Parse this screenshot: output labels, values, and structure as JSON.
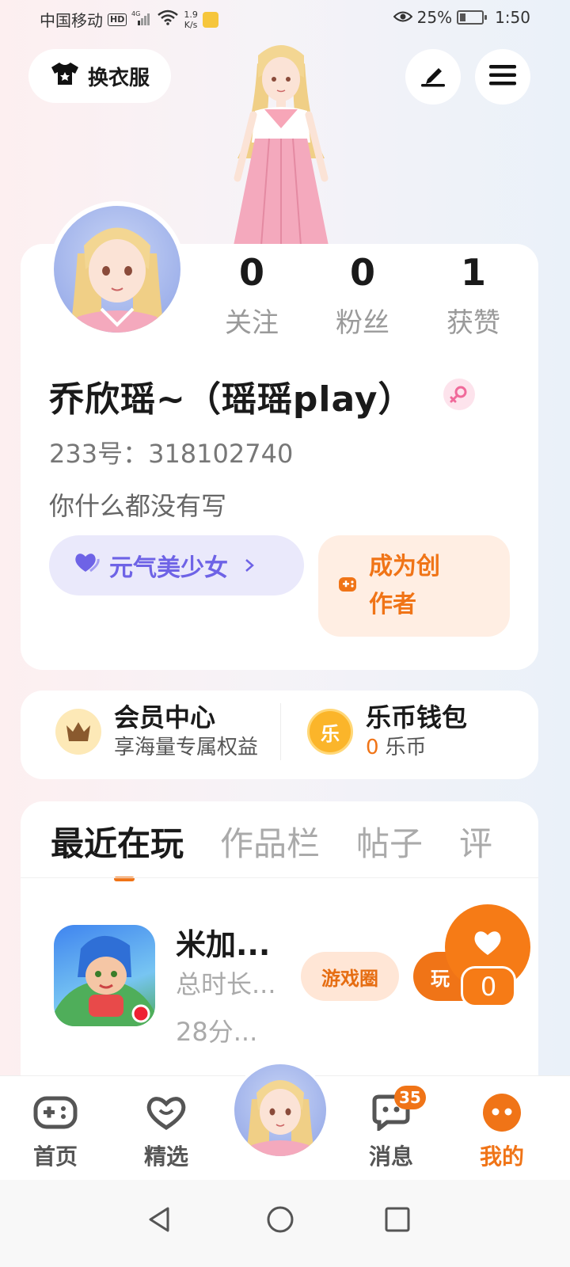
{
  "status_bar": {
    "carrier": "中国移动",
    "hd": "HD",
    "network": "4G",
    "speed_value": "1.9",
    "speed_unit": "K/s",
    "battery": "25%",
    "time": "1:50"
  },
  "header": {
    "outfit_label": "换衣服",
    "edit_icon": "pen-icon",
    "menu_icon": "hamburger-menu-icon"
  },
  "profile": {
    "stats": [
      {
        "value": "0",
        "label": "关注"
      },
      {
        "value": "0",
        "label": "粉丝"
      },
      {
        "value": "1",
        "label": "获赞"
      }
    ],
    "username": "乔欣瑶~（瑶瑶play）",
    "gender_icon": "female-icon",
    "uid": "233号：318102740",
    "bio": "你什么都没有写",
    "badge_label": "元气美少女",
    "creator_label": "成为创作者",
    "creator_line1": "成为创",
    "creator_line2": "作者"
  },
  "member": {
    "title": "会员中心",
    "subtitle": "享海量专属权益"
  },
  "wallet": {
    "title": "乐币钱包",
    "coin_glyph": "乐",
    "count": "0",
    "unit": "乐币"
  },
  "tabs": [
    {
      "label": "最近在玩",
      "active": true
    },
    {
      "label": "作品栏",
      "active": false
    },
    {
      "label": "帖子",
      "active": false
    },
    {
      "label": "评",
      "active": false
    }
  ],
  "recent_game": {
    "title": "米加...",
    "time_label": "总时长...",
    "time_value": "28分...",
    "circle_label": "游戏圈",
    "play_label": "玩"
  },
  "like_float": {
    "count": "0"
  },
  "bottom_nav": {
    "items": [
      {
        "label": "首页",
        "icon": "gamepad-icon"
      },
      {
        "label": "精选",
        "icon": "heart-icon"
      },
      {
        "label": "消息",
        "icon": "chat-icon",
        "badge": "35"
      },
      {
        "label": "我的",
        "icon": "profile-icon",
        "active": true
      }
    ]
  },
  "colors": {
    "accent": "#f07417",
    "badge_purple": "#6e63e6",
    "text_primary": "#1a1a1a",
    "text_muted": "#9a9a9a"
  }
}
